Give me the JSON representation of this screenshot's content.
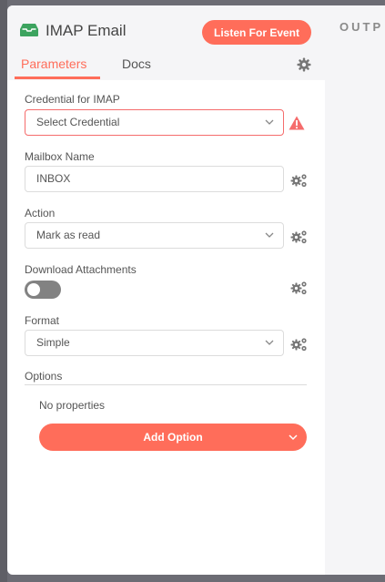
{
  "node": {
    "title": "IMAP Email",
    "listen_button": "Listen For Event"
  },
  "tabs": {
    "parameters": "Parameters",
    "docs": "Docs"
  },
  "output_title": "OUTP",
  "fields": {
    "credential": {
      "label": "Credential for IMAP",
      "value": "Select Credential",
      "status": "error"
    },
    "mailbox": {
      "label": "Mailbox Name",
      "value": "INBOX"
    },
    "action": {
      "label": "Action",
      "value": "Mark as read"
    },
    "download": {
      "label": "Download Attachments",
      "enabled": false
    },
    "format": {
      "label": "Format",
      "value": "Simple"
    }
  },
  "options": {
    "label": "Options",
    "empty_text": "No properties",
    "add_button": "Add Option"
  },
  "colors": {
    "accent": "#ff6d5a",
    "node_icon": "#3ca35f",
    "warning": "#f56c6c"
  }
}
